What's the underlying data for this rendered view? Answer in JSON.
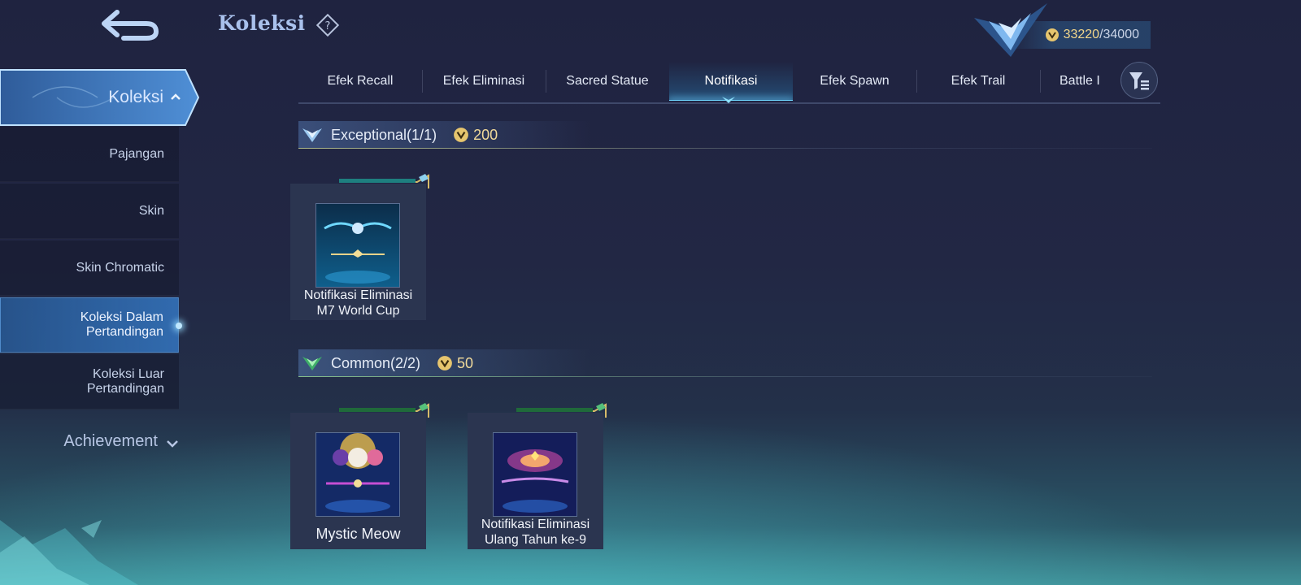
{
  "header": {
    "title": "Koleksi",
    "currency_current": "33220",
    "currency_max": "/34000"
  },
  "sidebar": {
    "main_label": "Koleksi",
    "items": [
      {
        "label_1": "Pajangan",
        "label_2": ""
      },
      {
        "label_1": "Skin",
        "label_2": ""
      },
      {
        "label_1": "Skin Chromatic",
        "label_2": ""
      },
      {
        "label_1": "Koleksi Dalam",
        "label_2": "Pertandingan"
      },
      {
        "label_1": "Koleksi Luar",
        "label_2": "Pertandingan"
      }
    ],
    "active_index": 3,
    "achievement_label": "Achievement"
  },
  "tabs": [
    "Efek Recall",
    "Efek Eliminasi",
    "Sacred Statue",
    "Notifikasi",
    "Efek Spawn",
    "Efek Trail",
    "Battle I"
  ],
  "active_tab": "Notifikasi",
  "sections": {
    "exceptional": {
      "title": "Exceptional(1/1)",
      "points": "200",
      "items": [
        {
          "name_1": "Notifikasi Eliminasi",
          "name_2": "M7 World Cup"
        }
      ]
    },
    "common": {
      "title": "Common(2/2)",
      "points": "50",
      "items": [
        {
          "name_1": "Mystic Meow",
          "name_2": ""
        },
        {
          "name_1": "Notifikasi Eliminasi",
          "name_2": "Ulang Tahun ke-9"
        }
      ]
    }
  },
  "colors": {
    "accent": "#6fd8ff",
    "gold": "#f0d99a",
    "sidebar_active": "#2f6fb4"
  },
  "icons": {
    "back": "back-arrow-icon",
    "help": "help-icon",
    "filter": "filter-icon",
    "coin": "star-coin-icon"
  }
}
